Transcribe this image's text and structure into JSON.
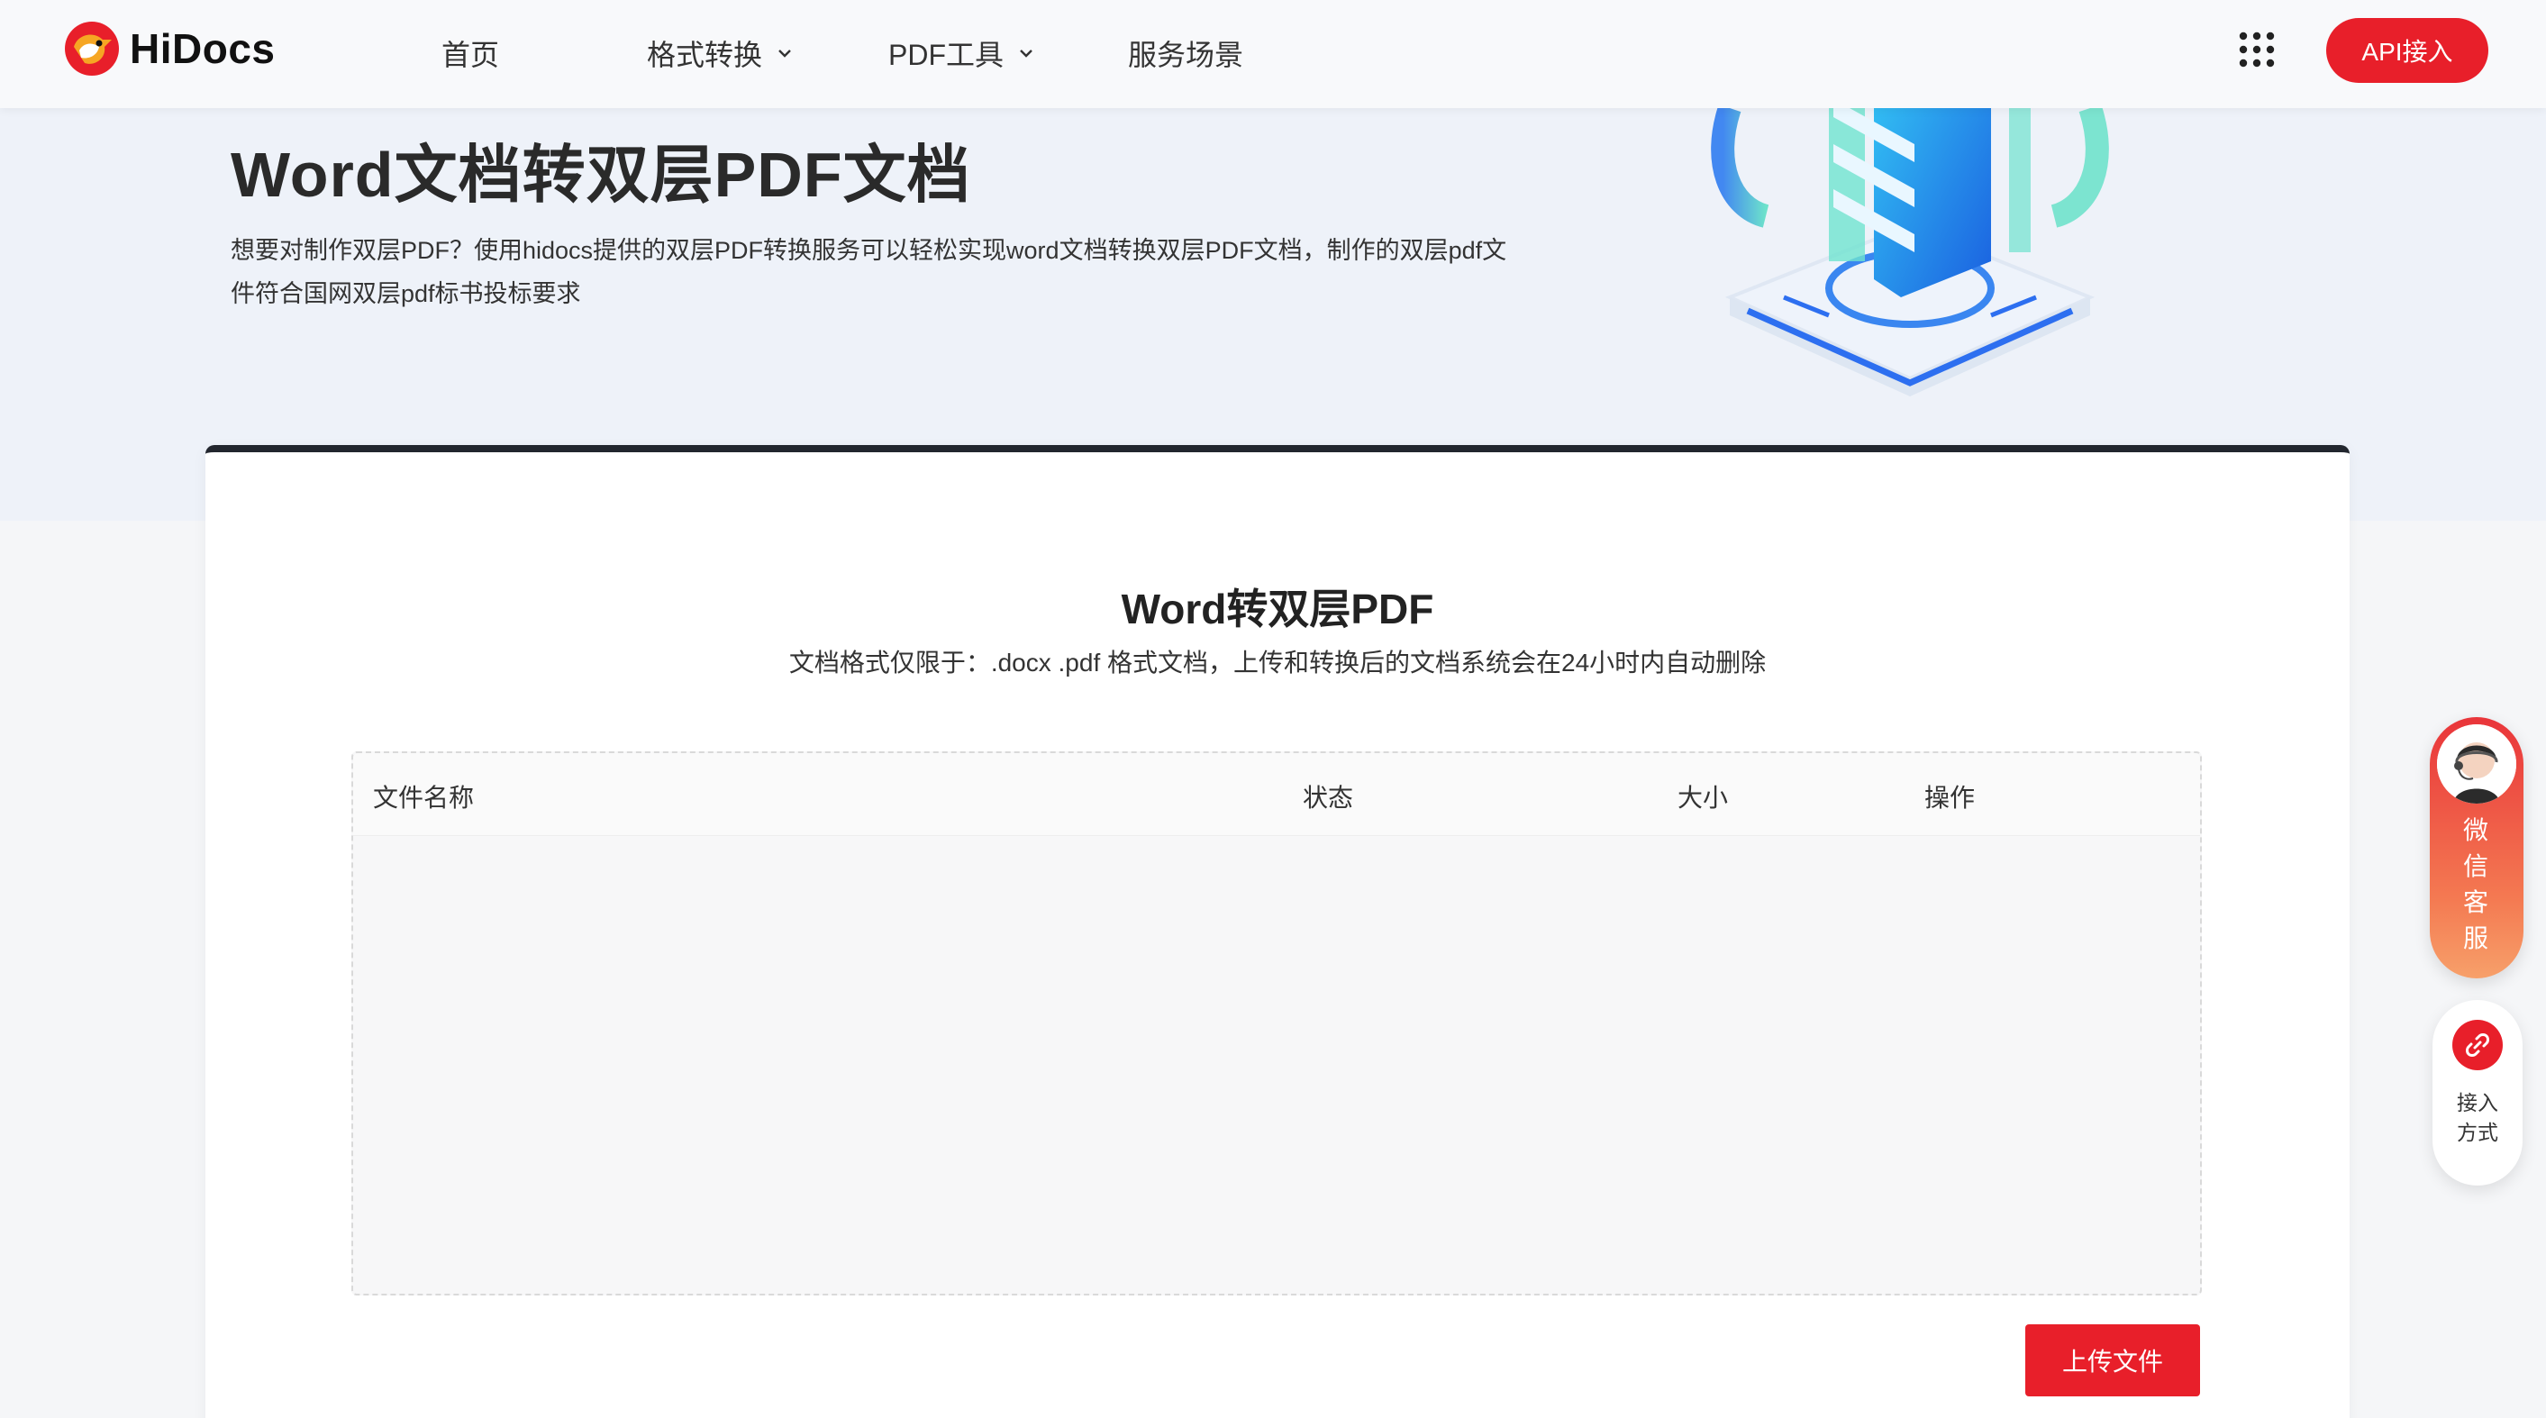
{
  "brand": {
    "name": "HiDocs",
    "accent": "#e81f2a"
  },
  "nav": {
    "items": [
      {
        "label": "首页",
        "has_dropdown": false
      },
      {
        "label": "格式转换",
        "has_dropdown": true
      },
      {
        "label": "PDF工具",
        "has_dropdown": true
      },
      {
        "label": "服务场景",
        "has_dropdown": false
      }
    ],
    "apps_icon": "grid-icon",
    "api_button": "API接入"
  },
  "hero": {
    "title": "Word文档转双层PDF文档",
    "description": "想要对制作双层PDF？使用hidocs提供的双层PDF转换服务可以轻松实现word文档转换双层PDF文档，制作的双层pdf文件符合国网双层pdf标书投标要求"
  },
  "converter": {
    "title": "Word转双层PDF",
    "subtitle": "文档格式仅限于：.docx .pdf 格式文档，上传和转换后的文档系统会在24小时内自动删除",
    "table": {
      "columns": [
        "文件名称",
        "状态",
        "大小",
        "操作"
      ],
      "rows": []
    },
    "upload_button": "上传文件"
  },
  "floating": {
    "wechat_label": "微信客服",
    "connect_label_line1": "接入",
    "connect_label_line2": "方式"
  }
}
